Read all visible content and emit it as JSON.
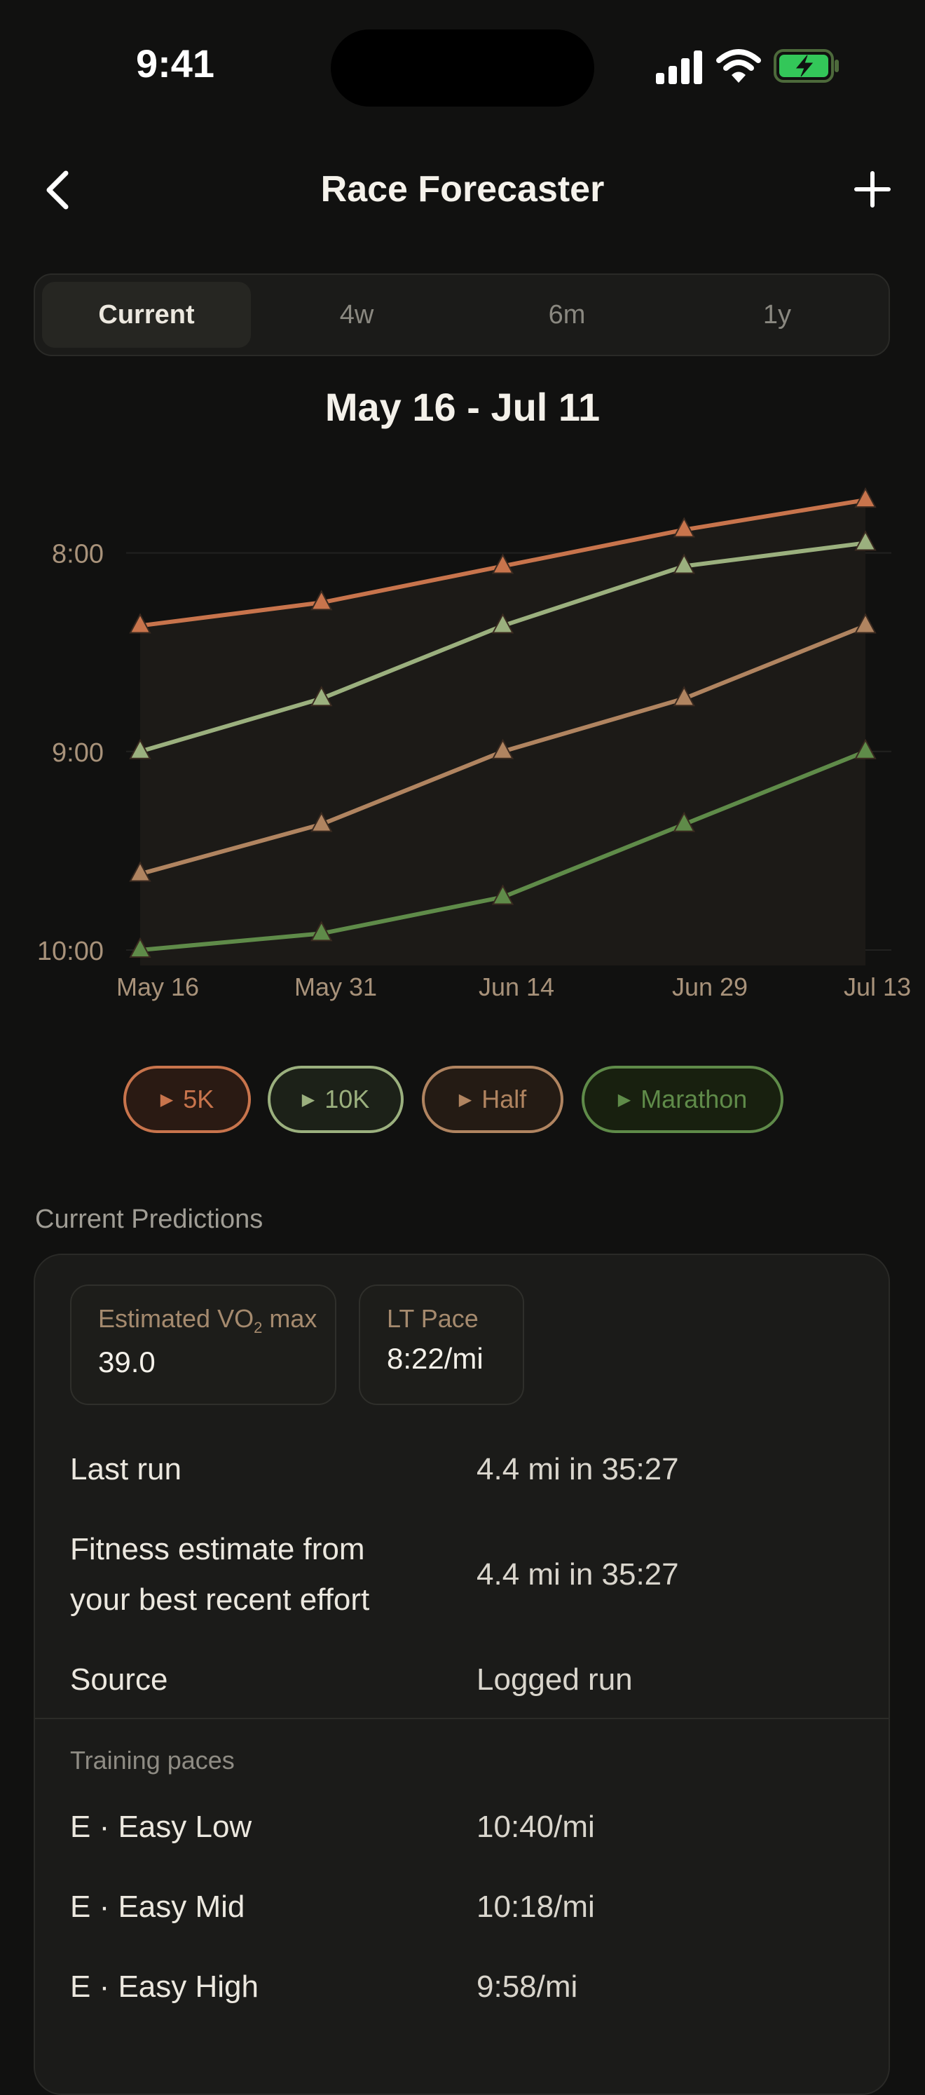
{
  "status": {
    "time": "9:41"
  },
  "nav": {
    "title": "Race Forecaster"
  },
  "segments": [
    "Current",
    "4w",
    "6m",
    "1y"
  ],
  "range_title": "May 16 - Jul 11",
  "chart_data": {
    "type": "line",
    "x": [
      "May 16",
      "May 31",
      "Jun 14",
      "Jun 29",
      "Jul 13"
    ],
    "y_ticks": [
      "8:00",
      "9:00",
      "10:00"
    ],
    "y_axis": "pace (min:sec), inverted — faster at top",
    "ylim": [
      "10:00",
      "7:55"
    ],
    "series": [
      {
        "name": "5K",
        "color": "#c8744c",
        "values": [
          "8:22",
          "8:15",
          "8:04",
          "7:53",
          "7:44"
        ]
      },
      {
        "name": "10K",
        "color": "#9bb07e",
        "values": [
          "9:00",
          "8:44",
          "8:22",
          "8:04",
          "7:57"
        ]
      },
      {
        "name": "Half",
        "color": "#b08460",
        "values": [
          "9:37",
          "9:22",
          "9:00",
          "8:44",
          "8:22"
        ]
      },
      {
        "name": "Marathon",
        "color": "#5f8b49",
        "values": [
          "10:00",
          "9:55",
          "9:44",
          "9:22",
          "9:00"
        ]
      }
    ],
    "grid": true
  },
  "legend_chips": [
    {
      "label": "5K",
      "color": "#c8744c",
      "bg": "#2a1a13"
    },
    {
      "label": "10K",
      "color": "#9bb07e",
      "bg": "#1c2118"
    },
    {
      "label": "Half",
      "color": "#b08460",
      "bg": "#241b14"
    },
    {
      "label": "Marathon",
      "color": "#5f8b49",
      "bg": "#18200f"
    }
  ],
  "predictions": {
    "section_label": "Current Predictions",
    "vo2_label_prefix": "Estimated VO",
    "vo2_label_sub": "2",
    "vo2_label_suffix": " max",
    "vo2_value": "39.0",
    "lt_label": "LT Pace",
    "lt_value": "8:22/mi",
    "rows": [
      {
        "label": "Last run",
        "value": "4.4 mi in 35:27"
      },
      {
        "label_line1": "Fitness estimate from",
        "label_line2": "your best recent effort",
        "value": "4.4 mi in 35:27"
      },
      {
        "label": "Source",
        "value": "Logged run"
      }
    ],
    "training_label": "Training paces",
    "paces": [
      {
        "label": "E · Easy Low",
        "value": "10:40/mi"
      },
      {
        "label": "E · Easy Mid",
        "value": "10:18/mi"
      },
      {
        "label": "E · Easy High",
        "value": "9:58/mi"
      }
    ]
  }
}
